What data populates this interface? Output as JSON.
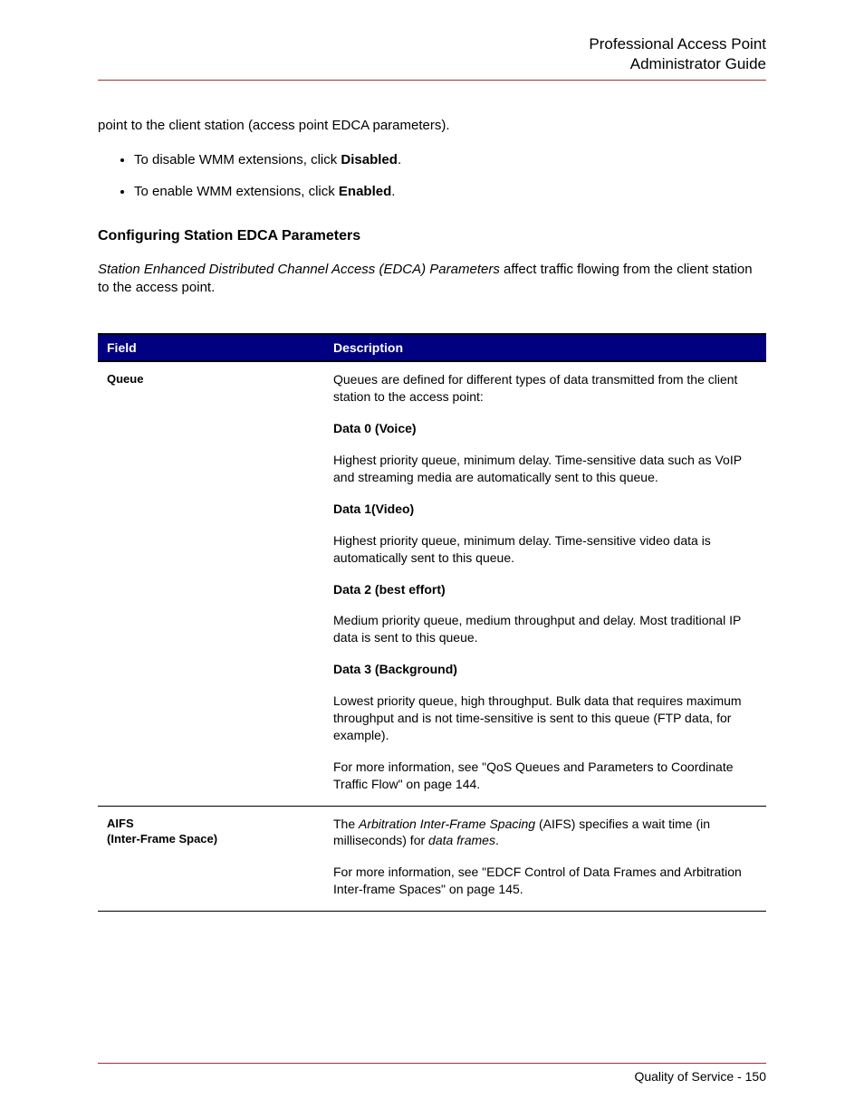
{
  "header": {
    "line1": "Professional Access Point",
    "line2": "Administrator Guide"
  },
  "intro_fragment": "point to the client station (access point EDCA parameters).",
  "bullets": [
    {
      "prefix": "To disable WMM extensions, click ",
      "bold": "Disabled",
      "suffix": "."
    },
    {
      "prefix": "To enable WMM extensions, click ",
      "bold": "Enabled",
      "suffix": "."
    }
  ],
  "section_heading": "Configuring Station EDCA Parameters",
  "section_intro_italic": "Station Enhanced Distributed Channel Access (EDCA) Parameters",
  "section_intro_rest": " affect traffic flowing from the client station to the access point.",
  "table": {
    "headers": {
      "field": "Field",
      "description": "Description"
    },
    "rows": [
      {
        "field": "Queue",
        "description": [
          {
            "type": "text",
            "value": "Queues are defined for different types of data transmitted from the client station to the access point:"
          },
          {
            "type": "bold",
            "value": "Data 0 (Voice)"
          },
          {
            "type": "text",
            "value": "Highest priority queue, minimum delay. Time-sensitive data such as VoIP and streaming media are automatically sent to this queue."
          },
          {
            "type": "bold",
            "value": "Data 1(Video)"
          },
          {
            "type": "text",
            "value": "Highest priority queue, minimum delay. Time-sensitive video data is automatically sent to this queue."
          },
          {
            "type": "bold",
            "value": "Data 2 (best effort)"
          },
          {
            "type": "text",
            "value": "Medium priority queue, medium throughput and delay. Most traditional IP data is sent to this queue."
          },
          {
            "type": "bold",
            "value": "Data 3 (Background)"
          },
          {
            "type": "text",
            "value": "Lowest priority queue, high throughput. Bulk data that requires maximum throughput and is not time-sensitive is sent to this queue (FTP data, for example)."
          },
          {
            "type": "text",
            "value": "For more information, see \"QoS Queues and Parameters to Coordinate Traffic Flow\" on page 144."
          }
        ]
      },
      {
        "field_lines": [
          "AIFS",
          "(Inter-Frame Space)"
        ],
        "description": [
          {
            "type": "mixed",
            "parts": [
              {
                "t": "The "
              },
              {
                "t": "Arbitration Inter-Frame Spacing",
                "italic": true
              },
              {
                "t": " (AIFS) specifies a wait time (in milliseconds) for "
              },
              {
                "t": "data frames",
                "italic": true
              },
              {
                "t": "."
              }
            ]
          },
          {
            "type": "text",
            "value": "For more information, see \"EDCF Control of Data Frames and Arbitration Inter-frame Spaces\" on page 145."
          }
        ]
      }
    ]
  },
  "footer": {
    "section": "Quality of Service",
    "sep": " - ",
    "page": "150"
  }
}
